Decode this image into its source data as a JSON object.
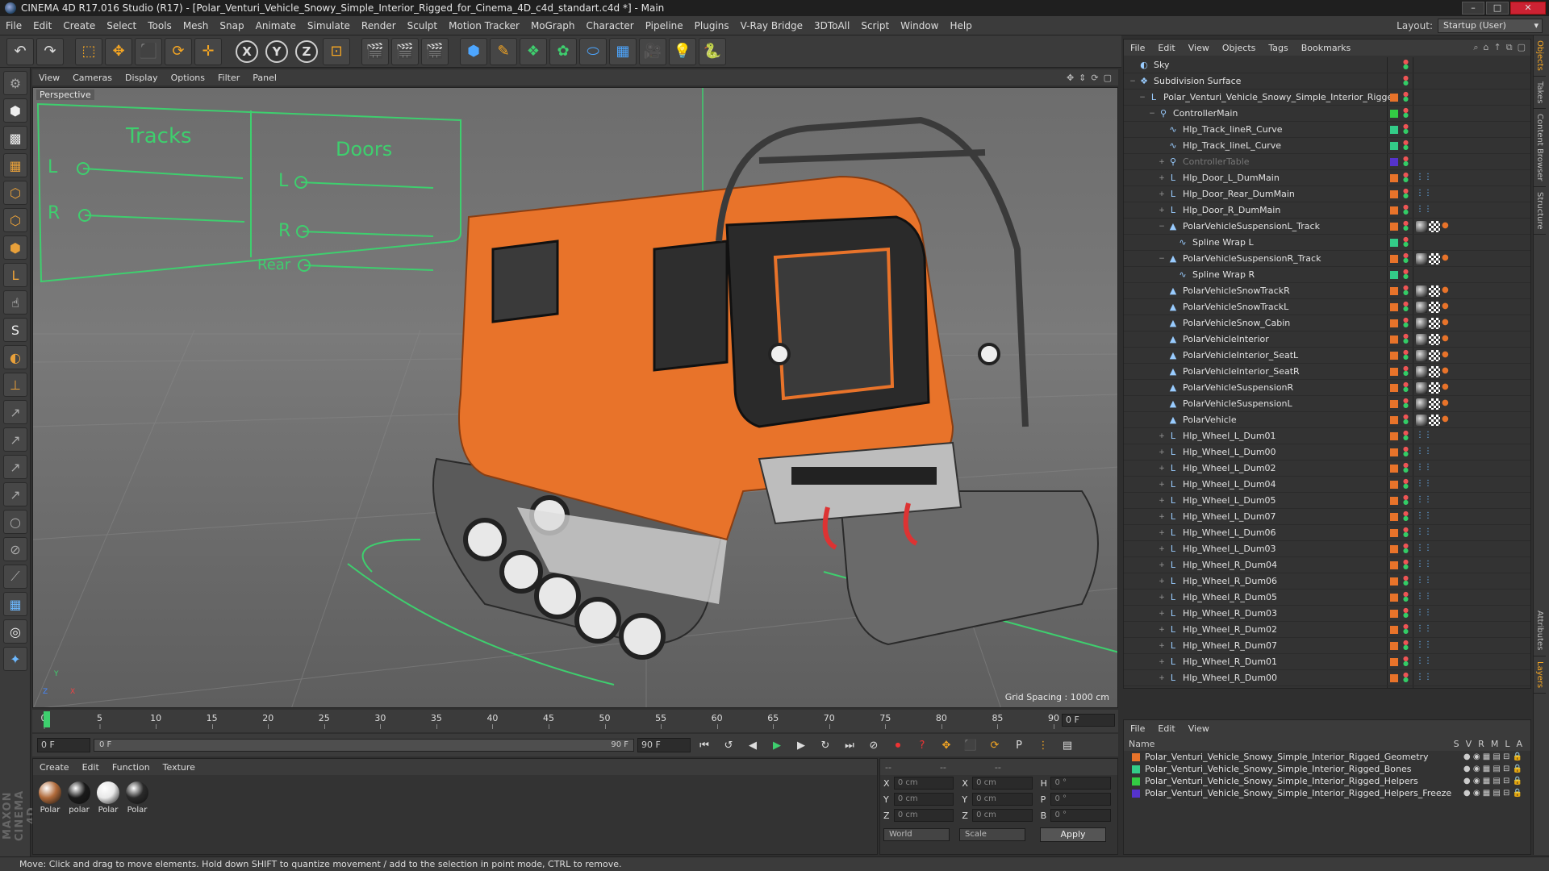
{
  "window": {
    "title": "CINEMA 4D R17.016 Studio (R17) - [Polar_Venturi_Vehicle_Snowy_Simple_Interior_Rigged_for_Cinema_4D_c4d_standart.c4d *] - Main",
    "buttons": [
      "–",
      "□",
      "✕"
    ]
  },
  "menu": [
    "File",
    "Edit",
    "Create",
    "Select",
    "Tools",
    "Mesh",
    "Snap",
    "Animate",
    "Simulate",
    "Render",
    "Sculpt",
    "Motion Tracker",
    "MoGraph",
    "Character",
    "Pipeline",
    "Plugins",
    "V-Ray Bridge",
    "3DToAll",
    "Script",
    "Window",
    "Help"
  ],
  "layout": {
    "label": "Layout:",
    "value": "Startup (User)"
  },
  "toolbar": {
    "undo": "↶",
    "redo": "↷",
    "select": "⬚",
    "move": "✥",
    "scale": "⬛",
    "rotate": "⟳",
    "add": "✛",
    "x": "X",
    "y": "Y",
    "z": "Z",
    "coord": "⊡",
    "render1": "🎬",
    "render2": "🎬",
    "render3": "🎬",
    "cube": "⬢",
    "pen": "✎",
    "subdiv": "❖",
    "mograph": "✿",
    "deform": "⬭",
    "floor": "▦",
    "camera": "🎥",
    "light": "💡",
    "python": "🐍"
  },
  "viewport": {
    "menu": [
      "View",
      "Cameras",
      "Display",
      "Options",
      "Filter",
      "Panel"
    ],
    "label": "Perspective",
    "grid_spacing": "Grid Spacing : 1000 cm",
    "hud": {
      "tracks": "Tracks",
      "doors": "Doors",
      "L": "L",
      "R": "R",
      "door_L": "L",
      "door_R": "R",
      "rear": "Rear"
    },
    "axis": {
      "x": "X",
      "y": "Y",
      "z": "Z"
    }
  },
  "timeline": {
    "ticks": [
      "0",
      "5",
      "10",
      "15",
      "20",
      "25",
      "30",
      "35",
      "40",
      "45",
      "50",
      "55",
      "60",
      "65",
      "70",
      "75",
      "80",
      "85",
      "90"
    ],
    "current": "0 F"
  },
  "transport": {
    "start": "0 F",
    "slider_start": "0 F",
    "slider_end": "90 F",
    "end": "90 F"
  },
  "materials": {
    "menu": [
      "Create",
      "Edit",
      "Function",
      "Texture"
    ],
    "items": [
      {
        "label": "Polar",
        "color": "#b06a3a"
      },
      {
        "label": "polar",
        "color": "#1a1a1a"
      },
      {
        "label": "Polar",
        "color": "#e8e8e8"
      },
      {
        "label": "Polar",
        "color": "#2a2a2a"
      }
    ]
  },
  "coords": {
    "head": [
      "--",
      "--",
      "--"
    ],
    "rows": [
      {
        "a": "X",
        "av": "0 cm",
        "b": "X",
        "bv": "0 cm",
        "c": "H",
        "cv": "0 °"
      },
      {
        "a": "Y",
        "av": "0 cm",
        "b": "Y",
        "bv": "0 cm",
        "c": "P",
        "cv": "0 °"
      },
      {
        "a": "Z",
        "av": "0 cm",
        "b": "Z",
        "bv": "0 cm",
        "c": "B",
        "cv": "0 °"
      }
    ],
    "world": "World",
    "scale": "Scale",
    "apply": "Apply"
  },
  "status": "Move: Click and drag to move elements. Hold down SHIFT to quantize movement / add to the selection in point mode, CTRL to remove.",
  "object_manager": {
    "menu": [
      "File",
      "Edit",
      "View",
      "Objects",
      "Tags",
      "Bookmarks"
    ],
    "rows": [
      {
        "name": "Sky",
        "indent": 0,
        "icon": "sky",
        "layer": "",
        "exp": ""
      },
      {
        "name": "Subdivision Surface",
        "indent": 0,
        "icon": "subd",
        "layer": "",
        "exp": "−"
      },
      {
        "name": "Polar_Venturi_Vehicle_Snowy_Simple_Interior_Rigged",
        "indent": 1,
        "icon": "null",
        "layer": "#e8732a",
        "exp": "−"
      },
      {
        "name": "ControllerMain",
        "indent": 2,
        "icon": "joint",
        "layer": "#33cc44",
        "exp": "−"
      },
      {
        "name": "Hlp_Track_lineR_Curve",
        "indent": 3,
        "icon": "spline",
        "layer": "#33cc88",
        "exp": ""
      },
      {
        "name": "Hlp_Track_lineL_Curve",
        "indent": 3,
        "icon": "spline",
        "layer": "#33cc88",
        "exp": ""
      },
      {
        "name": "ControllerTable",
        "indent": 3,
        "icon": "joint",
        "layer": "#5533cc",
        "exp": "+",
        "dim": true
      },
      {
        "name": "Hlp_Door_L_DumMain",
        "indent": 3,
        "icon": "null",
        "layer": "#e8732a",
        "exp": "+"
      },
      {
        "name": "Hlp_Door_Rear_DumMain",
        "indent": 3,
        "icon": "null",
        "layer": "#e8732a",
        "exp": "+"
      },
      {
        "name": "Hlp_Door_R_DumMain",
        "indent": 3,
        "icon": "null",
        "layer": "#e8732a",
        "exp": "+"
      },
      {
        "name": "PolarVehicleSuspensionL_Track",
        "indent": 3,
        "icon": "poly",
        "layer": "#e8732a",
        "exp": "−"
      },
      {
        "name": "Spline Wrap L",
        "indent": 4,
        "icon": "wrap",
        "layer": "#33cc88",
        "exp": ""
      },
      {
        "name": "PolarVehicleSuspensionR_Track",
        "indent": 3,
        "icon": "poly",
        "layer": "#e8732a",
        "exp": "−"
      },
      {
        "name": "Spline Wrap R",
        "indent": 4,
        "icon": "wrap",
        "layer": "#33cc88",
        "exp": ""
      },
      {
        "name": "PolarVehicleSnowTrackR",
        "indent": 3,
        "icon": "poly",
        "layer": "#e8732a",
        "exp": ""
      },
      {
        "name": "PolarVehicleSnowTrackL",
        "indent": 3,
        "icon": "poly",
        "layer": "#e8732a",
        "exp": ""
      },
      {
        "name": "PolarVehicleSnow_Cabin",
        "indent": 3,
        "icon": "poly",
        "layer": "#e8732a",
        "exp": ""
      },
      {
        "name": "PolarVehicleInterior",
        "indent": 3,
        "icon": "poly",
        "layer": "#e8732a",
        "exp": ""
      },
      {
        "name": "PolarVehicleInterior_SeatL",
        "indent": 3,
        "icon": "poly",
        "layer": "#e8732a",
        "exp": ""
      },
      {
        "name": "PolarVehicleInterior_SeatR",
        "indent": 3,
        "icon": "poly",
        "layer": "#e8732a",
        "exp": ""
      },
      {
        "name": "PolarVehicleSuspensionR",
        "indent": 3,
        "icon": "poly",
        "layer": "#e8732a",
        "exp": ""
      },
      {
        "name": "PolarVehicleSuspensionL",
        "indent": 3,
        "icon": "poly",
        "layer": "#e8732a",
        "exp": ""
      },
      {
        "name": "PolarVehicle",
        "indent": 3,
        "icon": "poly",
        "layer": "#e8732a",
        "exp": ""
      },
      {
        "name": "Hlp_Wheel_L_Dum01",
        "indent": 3,
        "icon": "null",
        "layer": "#e8732a",
        "exp": "+"
      },
      {
        "name": "Hlp_Wheel_L_Dum00",
        "indent": 3,
        "icon": "null",
        "layer": "#e8732a",
        "exp": "+"
      },
      {
        "name": "Hlp_Wheel_L_Dum02",
        "indent": 3,
        "icon": "null",
        "layer": "#e8732a",
        "exp": "+"
      },
      {
        "name": "Hlp_Wheel_L_Dum04",
        "indent": 3,
        "icon": "null",
        "layer": "#e8732a",
        "exp": "+"
      },
      {
        "name": "Hlp_Wheel_L_Dum05",
        "indent": 3,
        "icon": "null",
        "layer": "#e8732a",
        "exp": "+"
      },
      {
        "name": "Hlp_Wheel_L_Dum07",
        "indent": 3,
        "icon": "null",
        "layer": "#e8732a",
        "exp": "+"
      },
      {
        "name": "Hlp_Wheel_L_Dum06",
        "indent": 3,
        "icon": "null",
        "layer": "#e8732a",
        "exp": "+"
      },
      {
        "name": "Hlp_Wheel_L_Dum03",
        "indent": 3,
        "icon": "null",
        "layer": "#e8732a",
        "exp": "+"
      },
      {
        "name": "Hlp_Wheel_R_Dum04",
        "indent": 3,
        "icon": "null",
        "layer": "#e8732a",
        "exp": "+"
      },
      {
        "name": "Hlp_Wheel_R_Dum06",
        "indent": 3,
        "icon": "null",
        "layer": "#e8732a",
        "exp": "+"
      },
      {
        "name": "Hlp_Wheel_R_Dum05",
        "indent": 3,
        "icon": "null",
        "layer": "#e8732a",
        "exp": "+"
      },
      {
        "name": "Hlp_Wheel_R_Dum03",
        "indent": 3,
        "icon": "null",
        "layer": "#e8732a",
        "exp": "+"
      },
      {
        "name": "Hlp_Wheel_R_Dum02",
        "indent": 3,
        "icon": "null",
        "layer": "#e8732a",
        "exp": "+"
      },
      {
        "name": "Hlp_Wheel_R_Dum07",
        "indent": 3,
        "icon": "null",
        "layer": "#e8732a",
        "exp": "+"
      },
      {
        "name": "Hlp_Wheel_R_Dum01",
        "indent": 3,
        "icon": "null",
        "layer": "#e8732a",
        "exp": "+"
      },
      {
        "name": "Hlp_Wheel_R_Dum00",
        "indent": 3,
        "icon": "null",
        "layer": "#e8732a",
        "exp": "+"
      }
    ]
  },
  "layer_manager": {
    "menu": [
      "File",
      "Edit",
      "View"
    ],
    "cols": {
      "name": "Name",
      "s": "S",
      "v": "V",
      "r": "R",
      "m": "M",
      "l": "L",
      "a": "A"
    },
    "rows": [
      {
        "name": "Polar_Venturi_Vehicle_Snowy_Simple_Interior_Rigged_Geometry",
        "color": "#e8732a"
      },
      {
        "name": "Polar_Venturi_Vehicle_Snowy_Simple_Interior_Rigged_Bones",
        "color": "#33cc88"
      },
      {
        "name": "Polar_Venturi_Vehicle_Snowy_Simple_Interior_Rigged_Helpers",
        "color": "#33cc44"
      },
      {
        "name": "Polar_Venturi_Vehicle_Snowy_Simple_Interior_Rigged_Helpers_Freeze",
        "color": "#5533cc"
      }
    ]
  },
  "side_tabs": [
    "Objects",
    "Takes",
    "Content Browser",
    "Structure",
    "Attributes",
    "Layers"
  ],
  "colors": {
    "accent": "#f5a623",
    "vehicle_orange": "#e8732a",
    "hud_green": "#3ecf6e"
  }
}
